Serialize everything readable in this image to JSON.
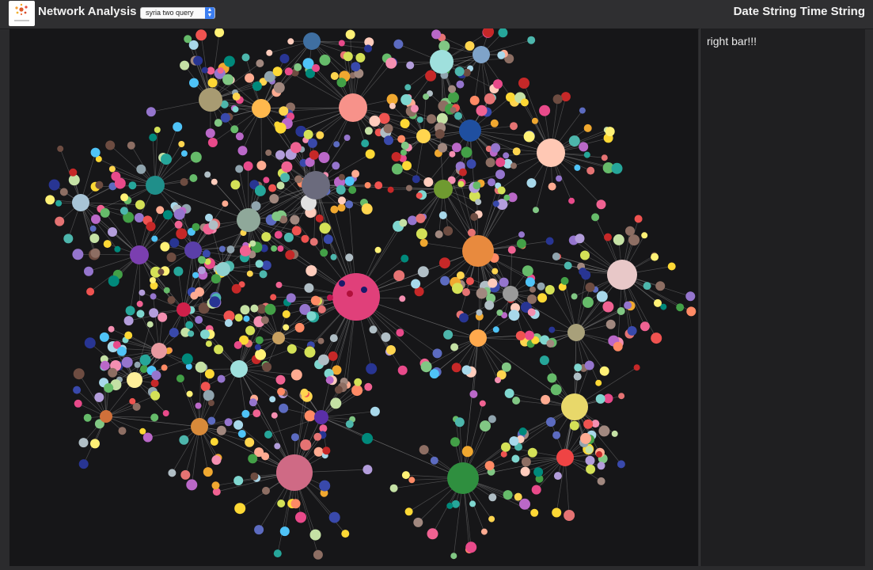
{
  "header": {
    "title": "Network Analysis",
    "dataset_select": {
      "selected": "syria two query"
    },
    "datetime": "Date String Time String"
  },
  "sidebar": {
    "text": "right bar!!!"
  },
  "colors": {
    "page_bg": "#2b2b2d",
    "graph_bg": "#161618",
    "edge": "#8a8a8a",
    "select_accent": "#3c7ef0"
  }
}
